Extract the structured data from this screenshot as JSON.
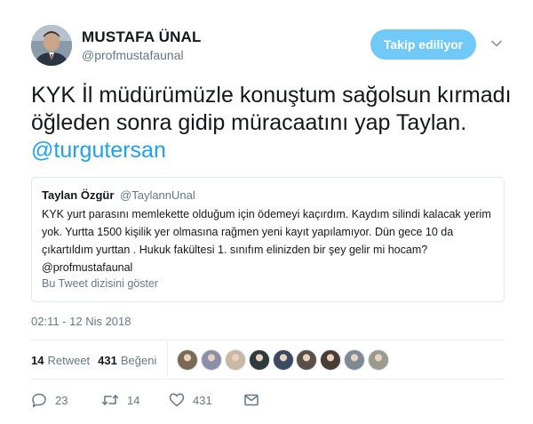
{
  "author": {
    "name": "MUSTAFA ÜNAL",
    "handle": "@profmustafaunal"
  },
  "follow_button": {
    "label": "Takip ediliyor",
    "color": "#71c9f8"
  },
  "tweet": {
    "text": "KYK İl müdürümüzle konuştum sağolsun kırmadı öğleden sonra gidip müracaatını yap Taylan.",
    "mention": "@turgutersan",
    "mention_color": "#1da1f2"
  },
  "quoted_tweet": {
    "name": "Taylan Özgür",
    "handle": "@TaylannUnal",
    "text": "KYK yurt parasını memlekette olduğum için ödemeyi kaçırdım. Kaydım silindi kalacak yerim yok. Yurtta 1500 kişilik yer olmasına rağmen yeni kayıt yapılamıyor. Dün gece 10 da çıkartıldım yurttan . Hukuk fakültesi 1. sınıfım elinizden bir şey gelir mi hocam? @profmustafaunal",
    "thread_link": "Bu Tweet dizisini göster"
  },
  "timestamp": "02:11 - 12 Nis 2018",
  "stats": {
    "retweet_count": "14",
    "retweet_label": "Retweet",
    "like_count": "431",
    "like_label": "Beğeni"
  },
  "likers": [
    {
      "icon": "avatar-1",
      "color": "#7a6a55"
    },
    {
      "icon": "avatar-2",
      "color": "#8c8fa8"
    },
    {
      "icon": "avatar-3",
      "color": "#c9b8a6"
    },
    {
      "icon": "avatar-4",
      "color": "#2f3a3a"
    },
    {
      "icon": "avatar-5",
      "color": "#3b4a5e"
    },
    {
      "icon": "avatar-6",
      "color": "#5b5048"
    },
    {
      "icon": "avatar-7",
      "color": "#4a3b34"
    },
    {
      "icon": "avatar-8",
      "color": "#7d8a95"
    },
    {
      "icon": "avatar-9",
      "color": "#9a9a8e"
    }
  ],
  "actions": {
    "reply_count": "23",
    "retweet_count": "14",
    "like_count": "431"
  }
}
